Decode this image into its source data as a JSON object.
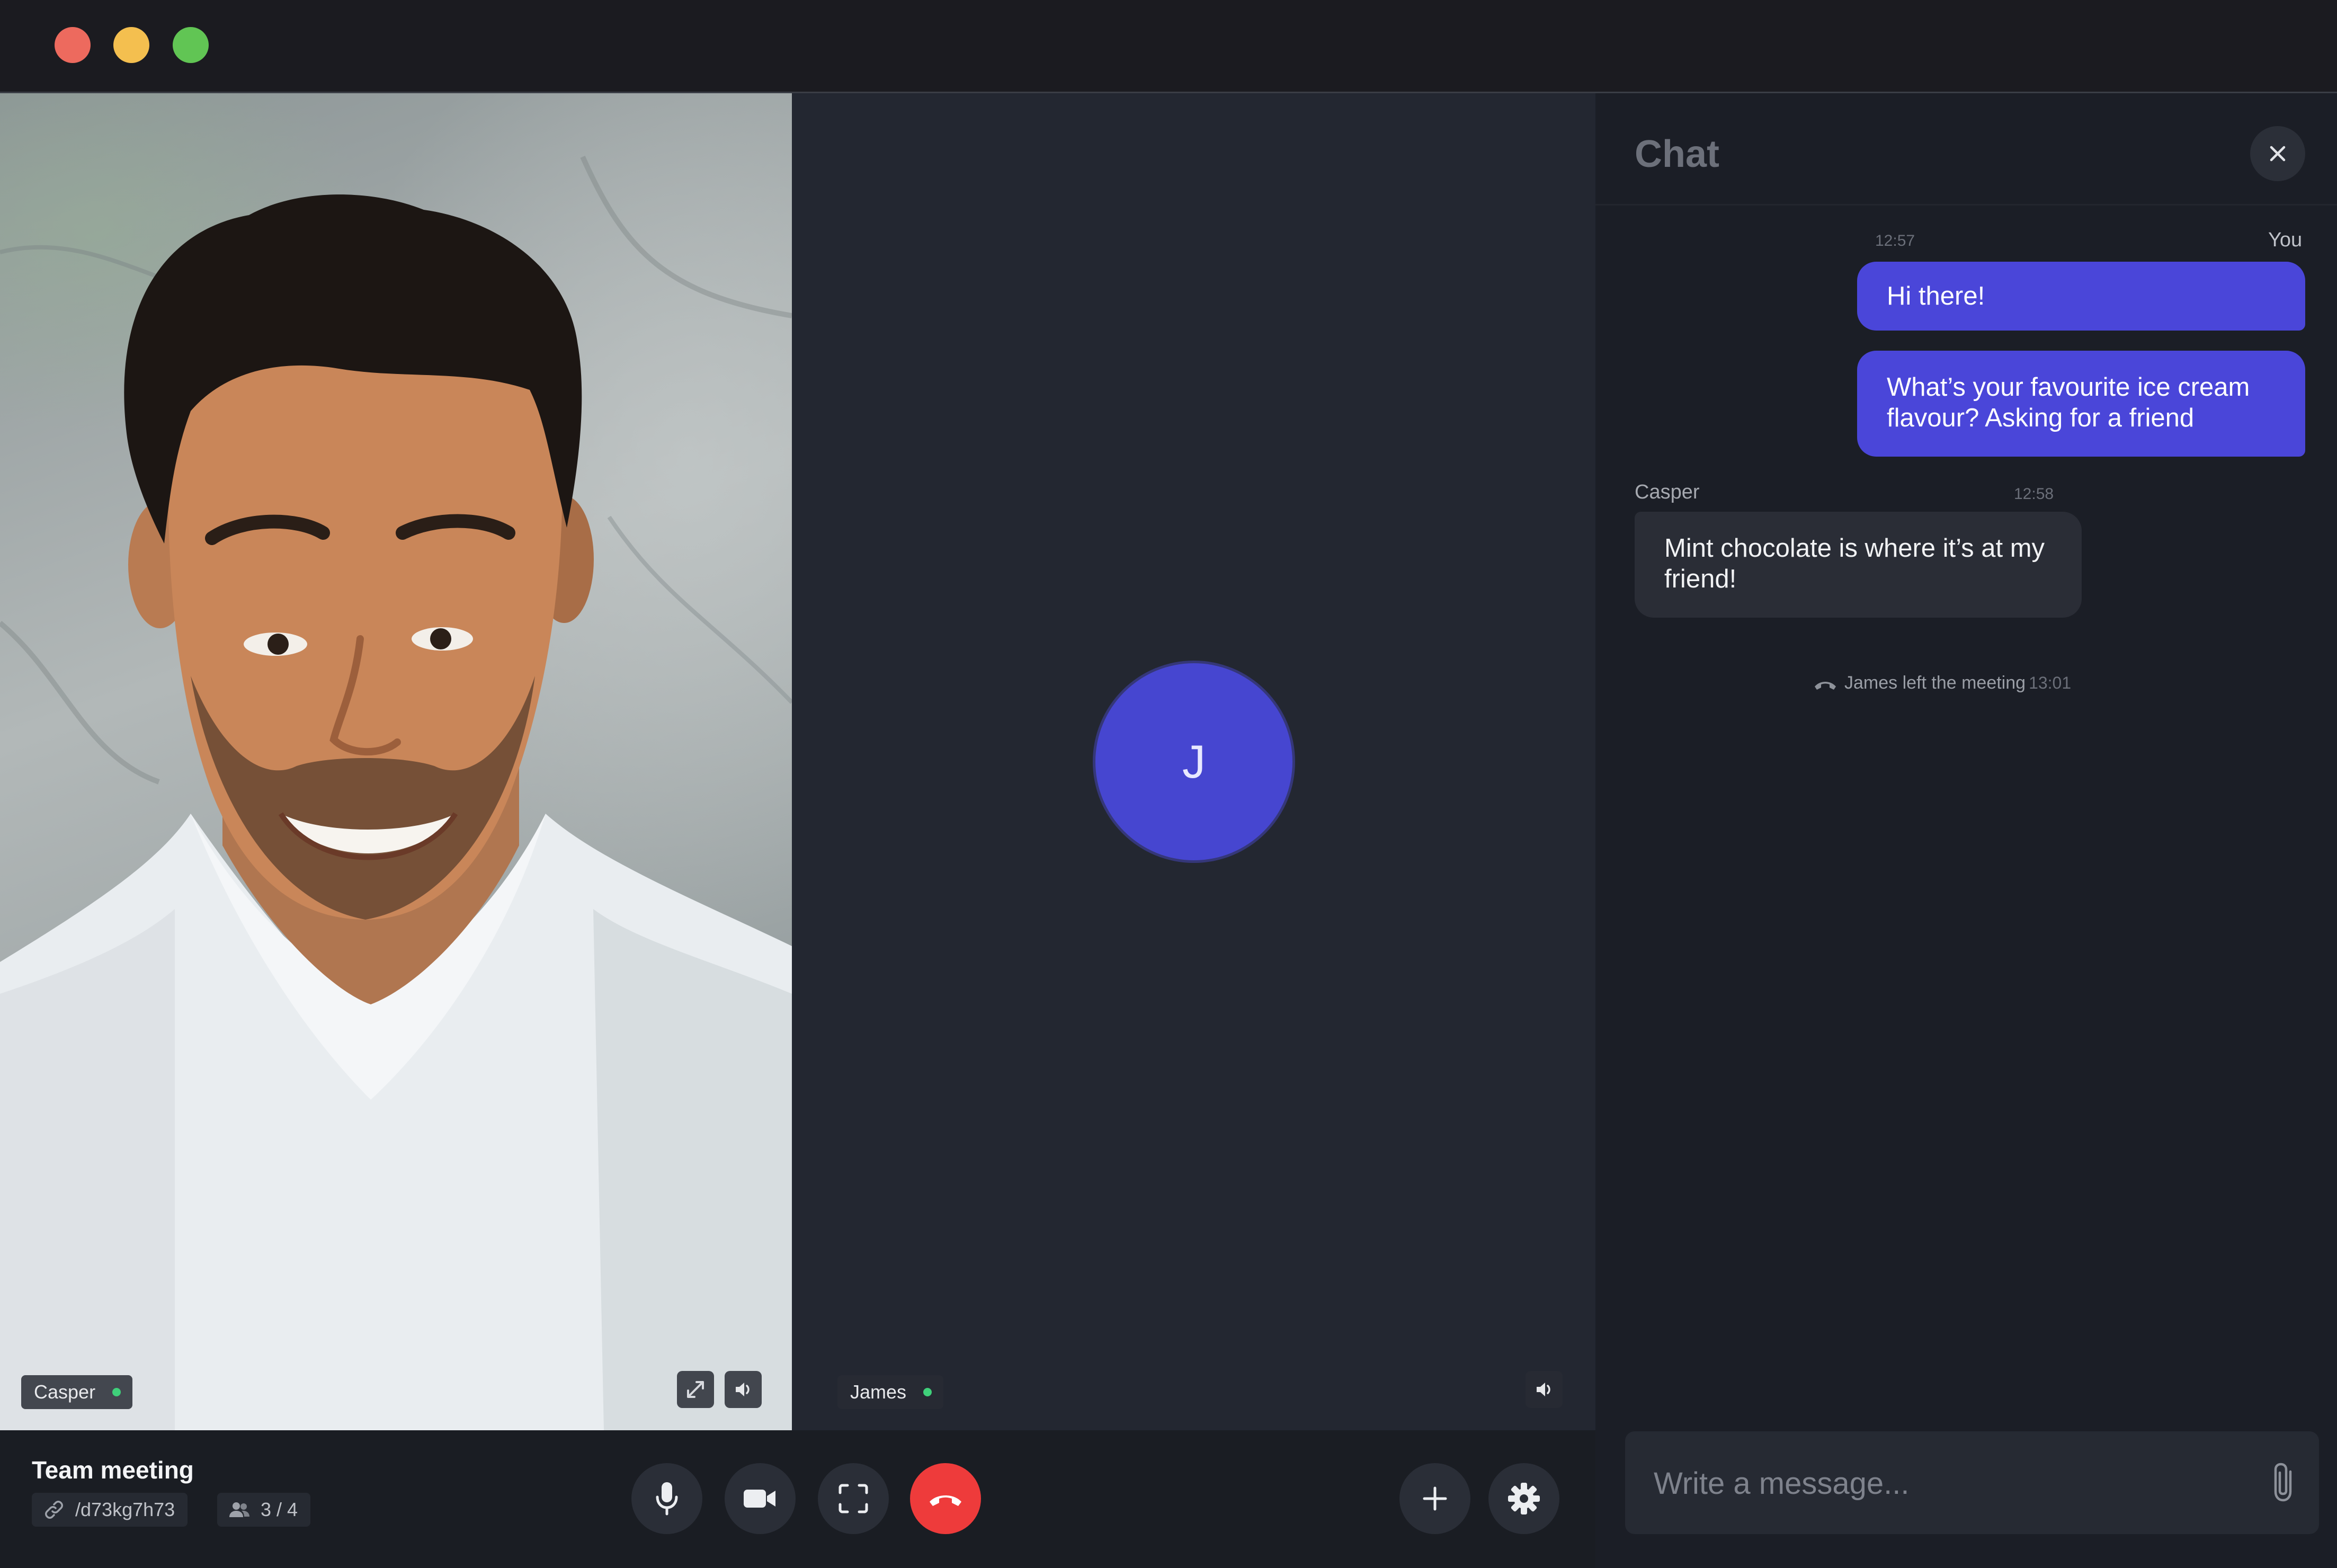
{
  "window": {
    "traffic_lights": {
      "close": "#ed6a5e",
      "minimize": "#f4bf4f",
      "zoom": "#61c554"
    }
  },
  "participants": [
    {
      "name": "Casper",
      "status_color": "#3fd07a"
    },
    {
      "name": "James",
      "status_color": "#3fd07a",
      "avatar_initial": "J",
      "avatar_color": "#4646d0"
    }
  ],
  "meeting": {
    "title": "Team meeting",
    "link": "/d73kg7h73",
    "participant_count": "3 / 4"
  },
  "controls": {
    "hangup_color": "#ee3b3b",
    "icons": [
      "microphone-icon",
      "video-camera-icon",
      "fullscreen-icon",
      "hang-up-icon",
      "add-icon",
      "settings-icon"
    ]
  },
  "chat": {
    "title": "Chat",
    "messages": [
      {
        "sender": "You",
        "time": "12:57",
        "text": "Hi there!"
      },
      {
        "sender": "You",
        "text": "What’s your favourite ice cream flavour? Asking for a friend"
      },
      {
        "sender": "Casper",
        "time": "12:58",
        "text": "Mint chocolate is where it’s at my friend!"
      }
    ],
    "system_event": {
      "text": "James left the meeting",
      "time": "13:01"
    },
    "composer_placeholder": "Write a message...",
    "accent_color": "#4a46d9"
  }
}
